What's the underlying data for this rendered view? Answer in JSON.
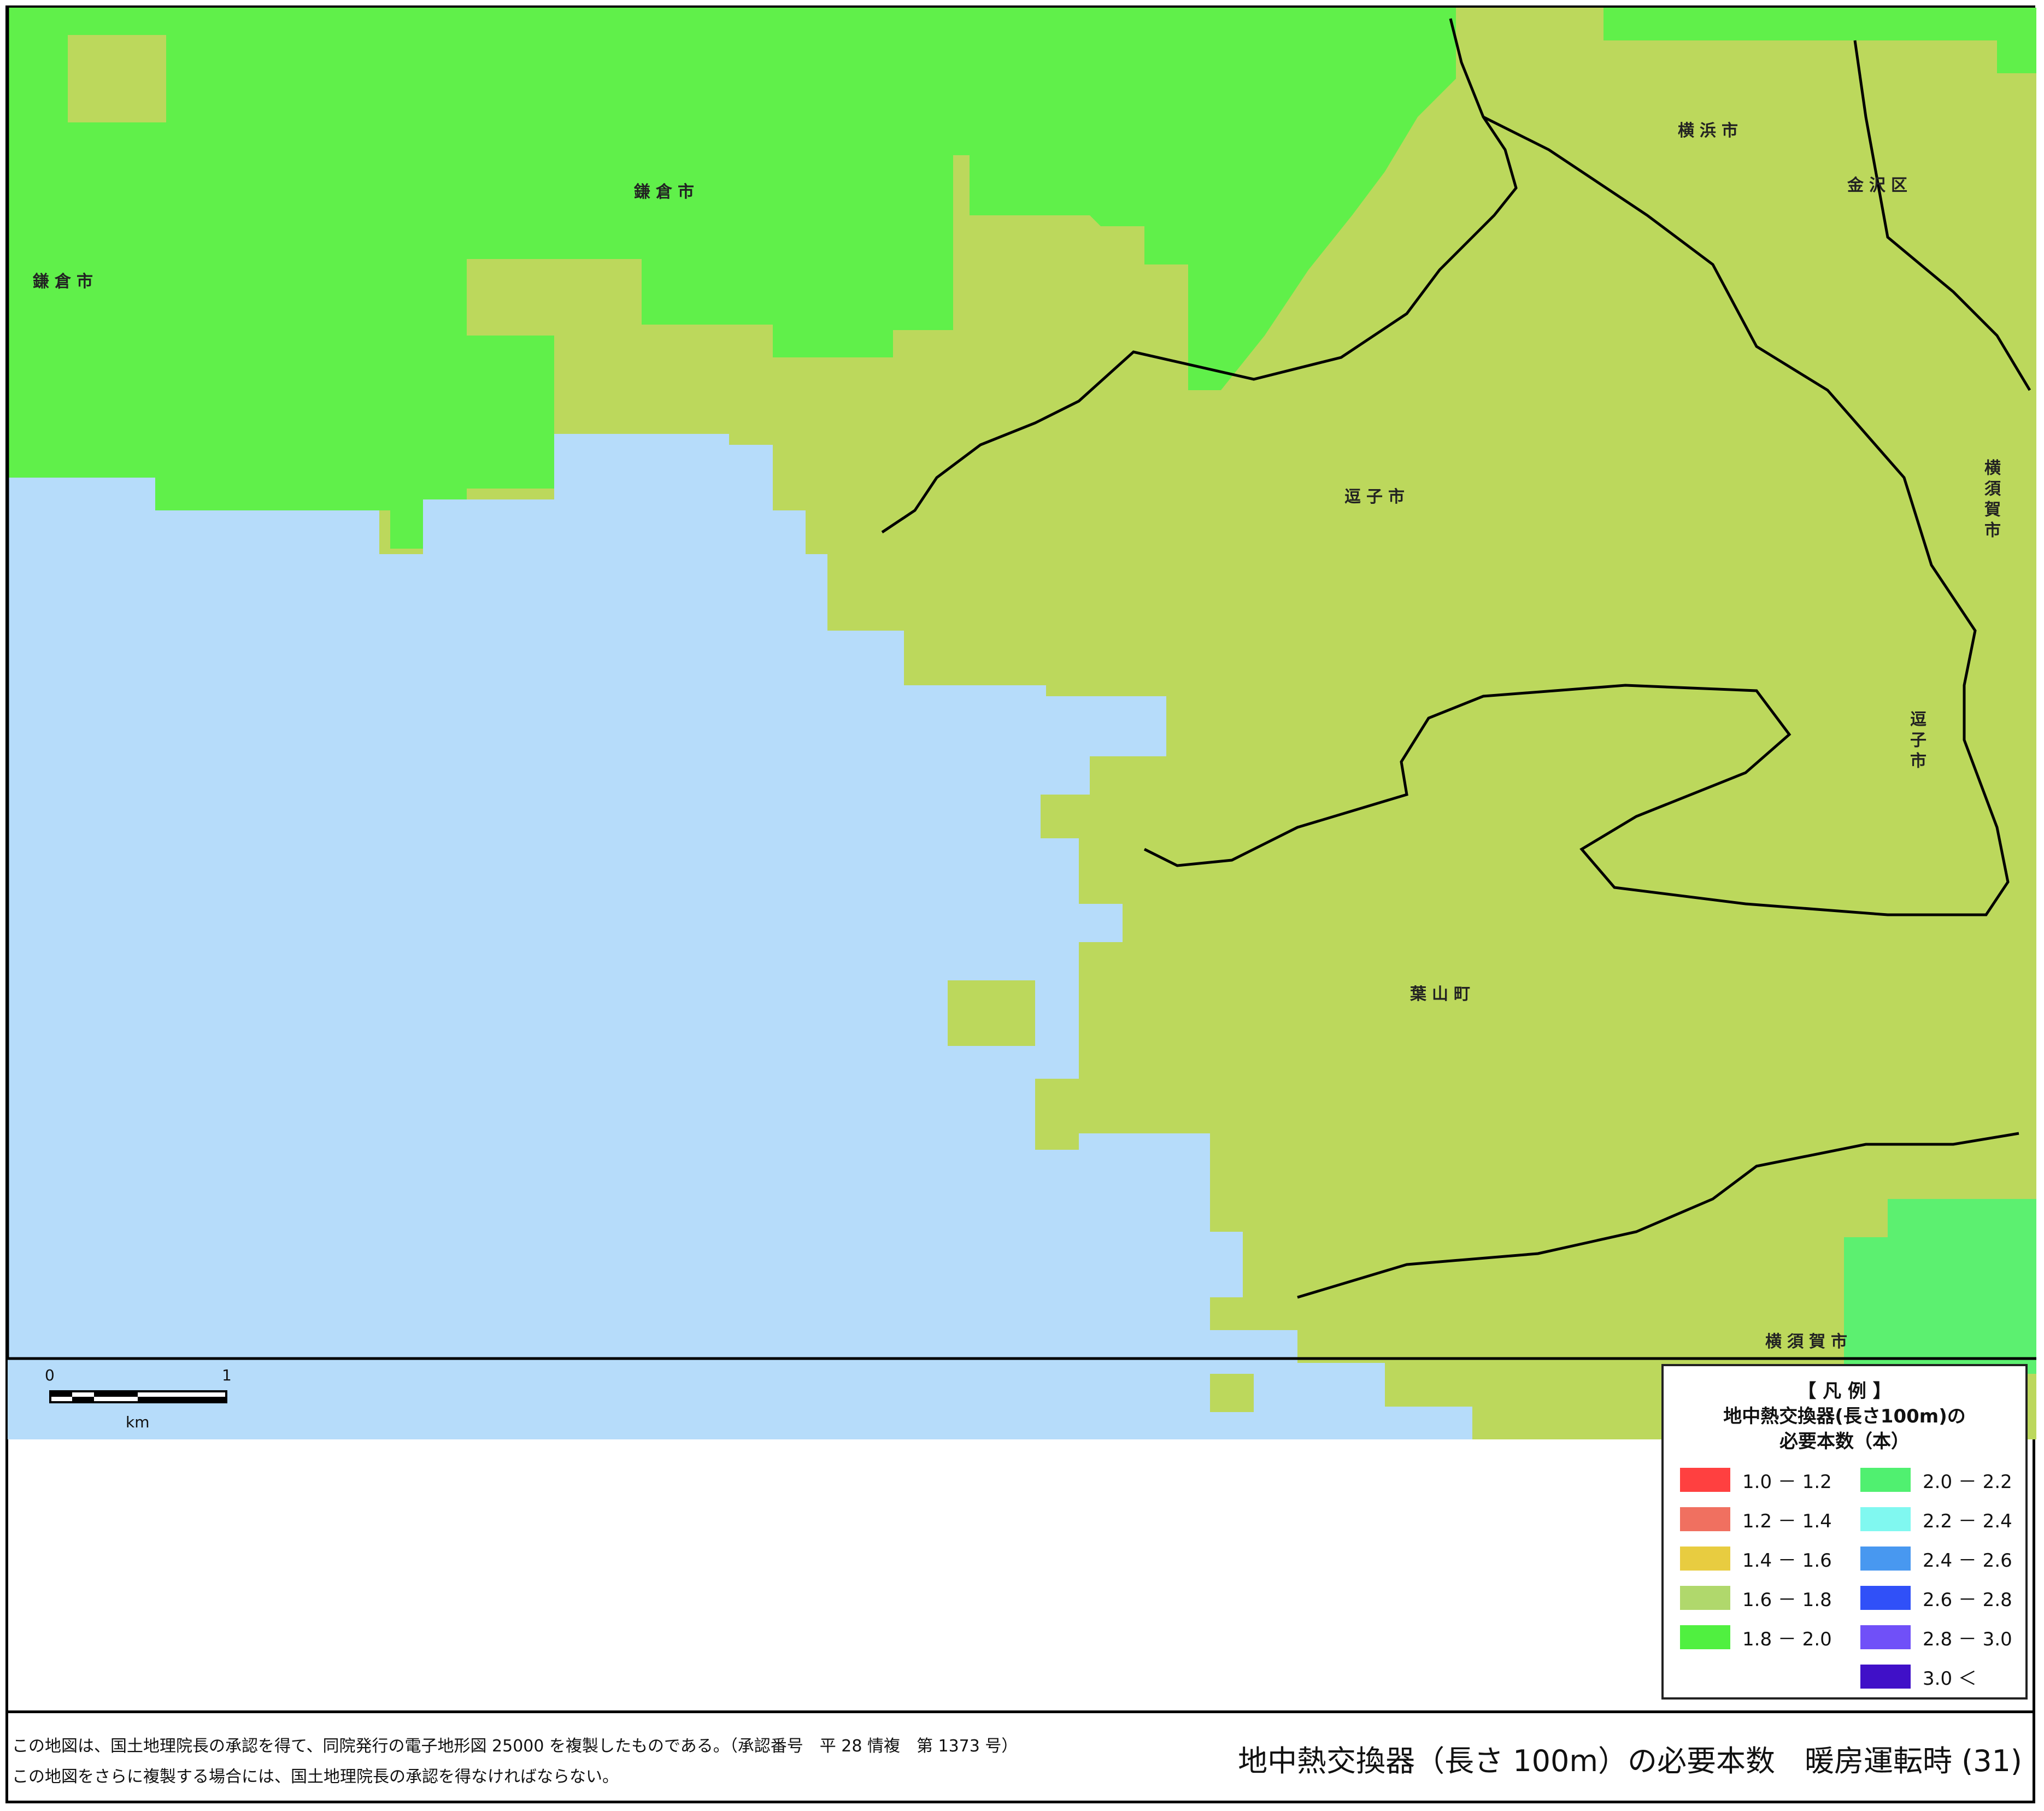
{
  "colors": {
    "sea": "#b6dcfa",
    "zone_1_8_2_0": "#60f04a",
    "zone_1_6_1_8": "#bcd85c",
    "zone_2_0_2_2": "#5cf070",
    "boundary": "#000000"
  },
  "map": {
    "places": [
      {
        "name": "鎌倉市",
        "kind": "city"
      },
      {
        "name": "鎌倉市",
        "kind": "city"
      },
      {
        "name": "横浜市",
        "kind": "city"
      },
      {
        "name": "金沢区",
        "kind": "ward"
      },
      {
        "name": "逗子市",
        "kind": "city"
      },
      {
        "name": "横須賀市",
        "kind": "city"
      },
      {
        "name": "逗子市",
        "kind": "city"
      },
      {
        "name": "葉山町",
        "kind": "town"
      },
      {
        "name": "横須賀市",
        "kind": "city"
      }
    ]
  },
  "scale": {
    "start": "0",
    "end": "1",
    "unit": "km"
  },
  "legend": {
    "title_line1": "【 凡 例 】",
    "title_line2": "地中熱交換器(長さ100m)の",
    "title_line3": "必要本数（本）",
    "items": [
      {
        "label": "1.0 － 1.2",
        "color": "#ff4040"
      },
      {
        "label": "1.2 － 1.4",
        "color": "#f07060"
      },
      {
        "label": "1.4 － 1.6",
        "color": "#e8cc40"
      },
      {
        "label": "1.6 － 1.8",
        "color": "#b0d86c"
      },
      {
        "label": "1.8 － 2.0",
        "color": "#50f040"
      },
      {
        "label": "2.0 － 2.2",
        "color": "#50f070"
      },
      {
        "label": "2.2 － 2.4",
        "color": "#80f8f0"
      },
      {
        "label": "2.4 － 2.6",
        "color": "#4898f0"
      },
      {
        "label": "2.6 － 2.8",
        "color": "#3050f8"
      },
      {
        "label": "2.8 － 3.0",
        "color": "#7050f8"
      },
      {
        "label": "3.0 ＜",
        "color": "#4010c8"
      }
    ]
  },
  "footer": {
    "note1": "この地図は、国土地理院長の承認を得て、同院発行の電子地形図 25000 を複製したものである。（承認番号　平 28 情複　第 1373 号）",
    "note2": "この地図をさらに複製する場合には、国土地理院長の承認を得なければならない。",
    "title": "地中熱交換器（長さ 100m）の必要本数　暖房運転時 (31)"
  }
}
